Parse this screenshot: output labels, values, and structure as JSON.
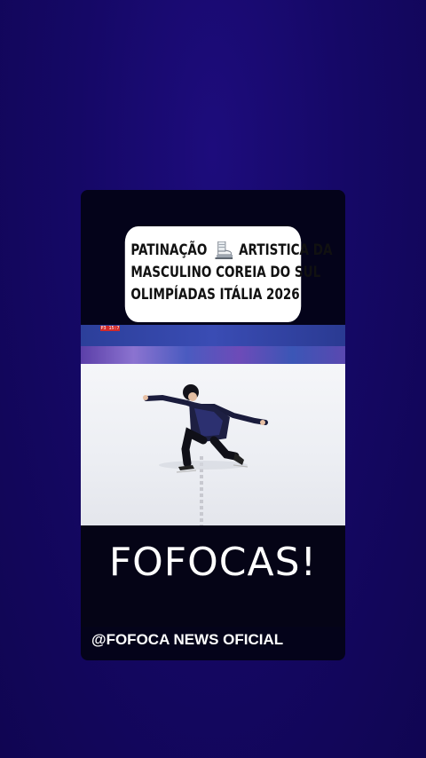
{
  "story": {
    "caption_lines": [
      "PATINAÇÃO",
      "ARTISTICA DA",
      "MASCULINO COREIA DO SUL",
      "OLIMPÍADAS ITÁLIA 2026"
    ],
    "caption_icon": "ice-skate-icon",
    "scoreboard_text": "P3 15:7",
    "logo_text": "FOFOCAS!",
    "handle": "@FOFOCA NEWS OFICIAL"
  },
  "colors": {
    "background": "#14086a",
    "card": "#04031a",
    "caption_bg": "#ffffff",
    "text_light": "#ffffff"
  }
}
